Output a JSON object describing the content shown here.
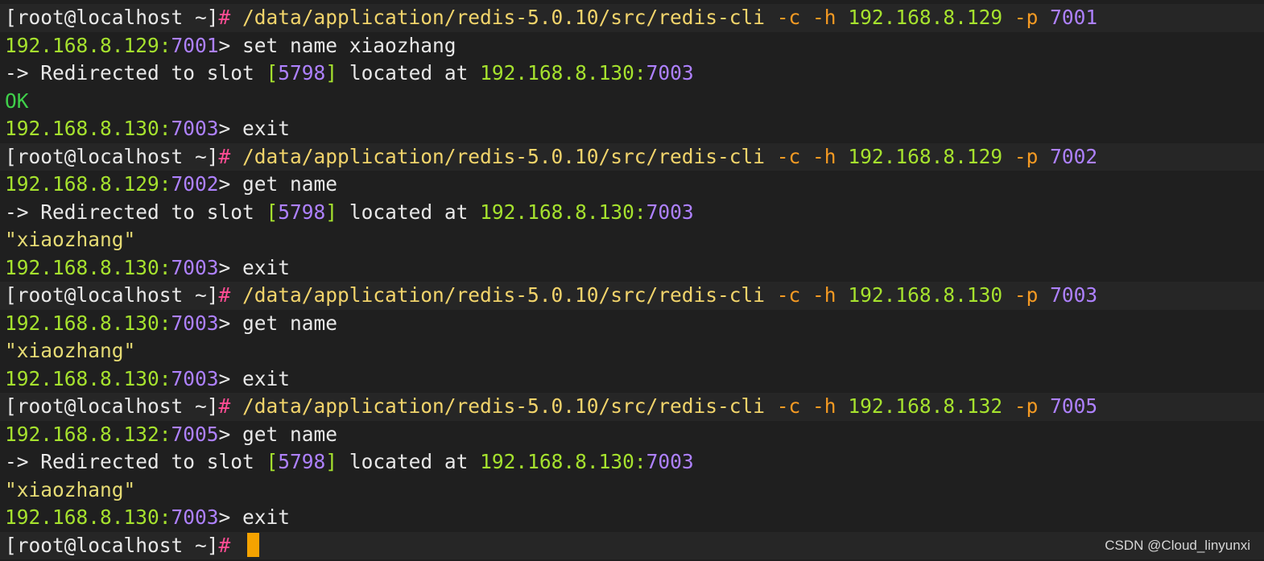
{
  "colors": {
    "text": "#e8e8e8",
    "bracket": "#e8e8e8",
    "hash": "#ff4d94",
    "path": "#f2d46b",
    "flag": "#f59a23",
    "host": "#a6e22e",
    "num": "#ae81ff",
    "ok": "#3fd04a",
    "str": "#e6db74",
    "cursor": "#f5a300"
  },
  "lines": [
    {
      "type": "prompt",
      "segments": [
        {
          "text": "[root@localhost ~]",
          "color": "text"
        },
        {
          "text": "# ",
          "color": "hash"
        },
        {
          "text": "/data/application/redis-5.0.10/src/redis-cli ",
          "color": "path"
        },
        {
          "text": "-c -h ",
          "color": "flag"
        },
        {
          "text": "192.168.8.129 ",
          "color": "host"
        },
        {
          "text": "-p ",
          "color": "flag"
        },
        {
          "text": "7001",
          "color": "num"
        }
      ]
    },
    {
      "type": "output",
      "segments": [
        {
          "text": "192.168.8.129:",
          "color": "host"
        },
        {
          "text": "7001",
          "color": "num"
        },
        {
          "text": "> set name xiaozhang",
          "color": "text"
        }
      ]
    },
    {
      "type": "output",
      "segments": [
        {
          "text": "-> Redirected to slot ",
          "color": "text"
        },
        {
          "text": "[",
          "color": "host"
        },
        {
          "text": "5798",
          "color": "num"
        },
        {
          "text": "] ",
          "color": "host"
        },
        {
          "text": "located at ",
          "color": "text"
        },
        {
          "text": "192.168.8.130:",
          "color": "host"
        },
        {
          "text": "7003",
          "color": "num"
        }
      ]
    },
    {
      "type": "output",
      "segments": [
        {
          "text": "OK",
          "color": "ok"
        }
      ]
    },
    {
      "type": "output",
      "segments": [
        {
          "text": "192.168.8.130:",
          "color": "host"
        },
        {
          "text": "7003",
          "color": "num"
        },
        {
          "text": "> exit",
          "color": "text"
        }
      ]
    },
    {
      "type": "prompt",
      "segments": [
        {
          "text": "[root@localhost ~]",
          "color": "text"
        },
        {
          "text": "# ",
          "color": "hash"
        },
        {
          "text": "/data/application/redis-5.0.10/src/redis-cli ",
          "color": "path"
        },
        {
          "text": "-c -h ",
          "color": "flag"
        },
        {
          "text": "192.168.8.129 ",
          "color": "host"
        },
        {
          "text": "-p ",
          "color": "flag"
        },
        {
          "text": "7002",
          "color": "num"
        }
      ]
    },
    {
      "type": "output",
      "segments": [
        {
          "text": "192.168.8.129:",
          "color": "host"
        },
        {
          "text": "7002",
          "color": "num"
        },
        {
          "text": "> get name",
          "color": "text"
        }
      ]
    },
    {
      "type": "output",
      "segments": [
        {
          "text": "-> Redirected to slot ",
          "color": "text"
        },
        {
          "text": "[",
          "color": "host"
        },
        {
          "text": "5798",
          "color": "num"
        },
        {
          "text": "] ",
          "color": "host"
        },
        {
          "text": "located at ",
          "color": "text"
        },
        {
          "text": "192.168.8.130:",
          "color": "host"
        },
        {
          "text": "7003",
          "color": "num"
        }
      ]
    },
    {
      "type": "output",
      "segments": [
        {
          "text": "\"xiaozhang\"",
          "color": "str"
        }
      ]
    },
    {
      "type": "output",
      "segments": [
        {
          "text": "192.168.8.130:",
          "color": "host"
        },
        {
          "text": "7003",
          "color": "num"
        },
        {
          "text": "> exit",
          "color": "text"
        }
      ]
    },
    {
      "type": "prompt",
      "segments": [
        {
          "text": "[root@localhost ~]",
          "color": "text"
        },
        {
          "text": "# ",
          "color": "hash"
        },
        {
          "text": "/data/application/redis-5.0.10/src/redis-cli ",
          "color": "path"
        },
        {
          "text": "-c -h ",
          "color": "flag"
        },
        {
          "text": "192.168.8.130 ",
          "color": "host"
        },
        {
          "text": "-p ",
          "color": "flag"
        },
        {
          "text": "7003",
          "color": "num"
        }
      ]
    },
    {
      "type": "output",
      "segments": [
        {
          "text": "192.168.8.130:",
          "color": "host"
        },
        {
          "text": "7003",
          "color": "num"
        },
        {
          "text": "> get name",
          "color": "text"
        }
      ]
    },
    {
      "type": "output",
      "segments": [
        {
          "text": "\"xiaozhang\"",
          "color": "str"
        }
      ]
    },
    {
      "type": "output",
      "segments": [
        {
          "text": "192.168.8.130:",
          "color": "host"
        },
        {
          "text": "7003",
          "color": "num"
        },
        {
          "text": "> exit",
          "color": "text"
        }
      ]
    },
    {
      "type": "prompt",
      "segments": [
        {
          "text": "[root@localhost ~]",
          "color": "text"
        },
        {
          "text": "# ",
          "color": "hash"
        },
        {
          "text": "/data/application/redis-5.0.10/src/redis-cli ",
          "color": "path"
        },
        {
          "text": "-c -h ",
          "color": "flag"
        },
        {
          "text": "192.168.8.132 ",
          "color": "host"
        },
        {
          "text": "-p ",
          "color": "flag"
        },
        {
          "text": "7005",
          "color": "num"
        }
      ]
    },
    {
      "type": "output",
      "segments": [
        {
          "text": "192.168.8.132:",
          "color": "host"
        },
        {
          "text": "7005",
          "color": "num"
        },
        {
          "text": "> get name",
          "color": "text"
        }
      ]
    },
    {
      "type": "output",
      "segments": [
        {
          "text": "-> Redirected to slot ",
          "color": "text"
        },
        {
          "text": "[",
          "color": "host"
        },
        {
          "text": "5798",
          "color": "num"
        },
        {
          "text": "] ",
          "color": "host"
        },
        {
          "text": "located at ",
          "color": "text"
        },
        {
          "text": "192.168.8.130:",
          "color": "host"
        },
        {
          "text": "7003",
          "color": "num"
        }
      ]
    },
    {
      "type": "output",
      "segments": [
        {
          "text": "\"xiaozhang\"",
          "color": "str"
        }
      ]
    },
    {
      "type": "output",
      "segments": [
        {
          "text": "192.168.8.130:",
          "color": "host"
        },
        {
          "text": "7003",
          "color": "num"
        },
        {
          "text": "> exit",
          "color": "text"
        }
      ]
    },
    {
      "type": "prompt",
      "cursor": true,
      "segments": [
        {
          "text": "[root@localhost ~]",
          "color": "text"
        },
        {
          "text": "# ",
          "color": "hash"
        }
      ]
    }
  ],
  "watermark": "CSDN @Cloud_linyunxi"
}
